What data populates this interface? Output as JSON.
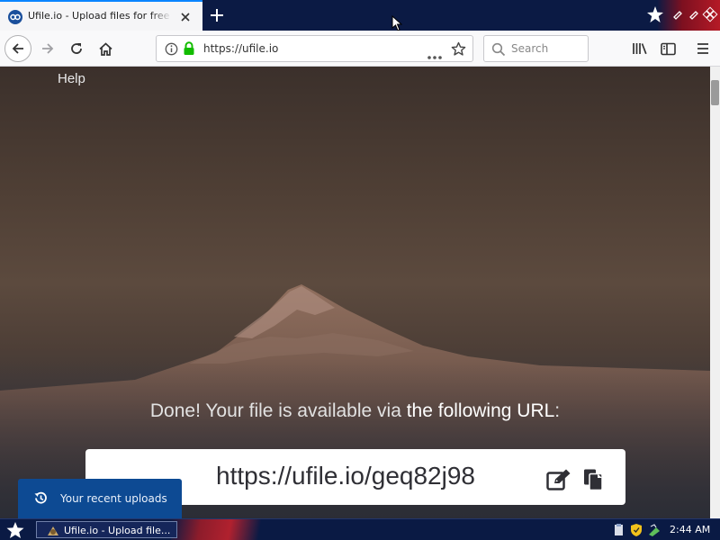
{
  "browser": {
    "tab_title": "Ufile.io - Upload files for free & share them",
    "url": "https://ufile.io",
    "search_placeholder": "Search"
  },
  "page": {
    "help_link": "Help",
    "done_prefix": "Done! Your file is available via ",
    "done_emphasis": "the following URL",
    "done_suffix": ":",
    "file_url": "https://ufile.io/geq82j98",
    "recent_uploads_label": "Your recent uploads"
  },
  "taskbar": {
    "task_label": "Ufile.io - Upload file...",
    "clock": "2:44 AM"
  },
  "colors": {
    "tab_accent": "#0a84ff",
    "secure_lock": "#12bc00",
    "recent_button": "#0d4a93",
    "taskbar": "#0a1a44"
  }
}
